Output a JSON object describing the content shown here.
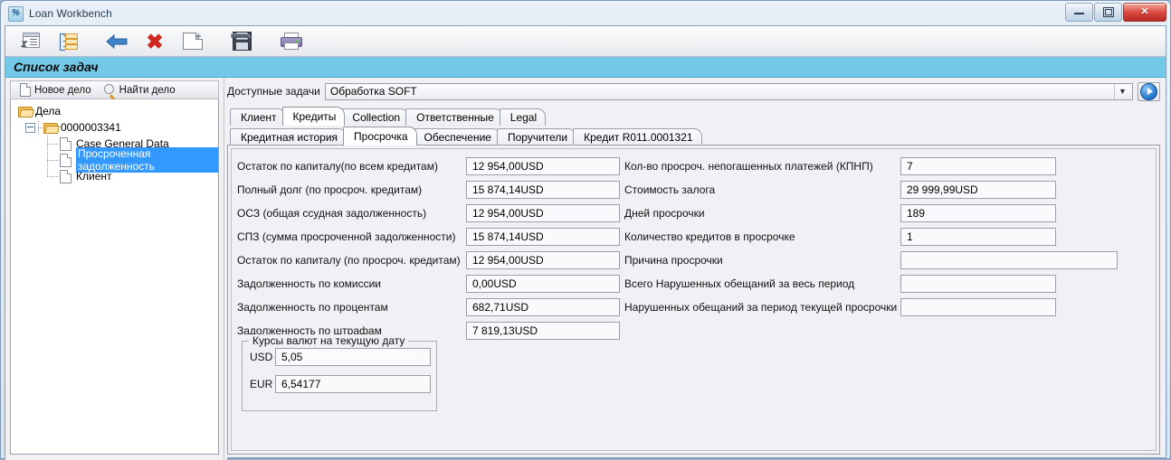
{
  "window": {
    "title": "Loan Workbench",
    "app_icon": "percent-icon",
    "controls": {
      "minimize": "minimize-icon",
      "maximize": "maximize-icon",
      "close": "✕"
    }
  },
  "toolbar": {
    "buttons": [
      {
        "name": "task-window-button",
        "icon": "task-window-icon"
      },
      {
        "name": "task-list-button",
        "icon": "list-tree-icon"
      },
      {
        "name": "back-button",
        "icon": "back-arrow-icon"
      },
      {
        "name": "delete-button",
        "icon": "red-cross-icon"
      },
      {
        "name": "new-document-button",
        "icon": "new-document-icon"
      },
      {
        "name": "save-button",
        "icon": "floppy-save-icon"
      },
      {
        "name": "print-button",
        "icon": "printer-icon"
      }
    ]
  },
  "band": {
    "title": "Список задач"
  },
  "left_panel": {
    "buttons": [
      {
        "label": "Новое дело",
        "icon": "document-icon"
      },
      {
        "label": "Найти дело",
        "icon": "magnifier-icon"
      }
    ],
    "tree": {
      "root": "Дела",
      "case_number": "0000003341",
      "children": [
        {
          "label": "Case General Data",
          "selected": false
        },
        {
          "label": "Просроченная задолженность",
          "selected": true
        },
        {
          "label": "Клиент",
          "selected": false
        }
      ]
    }
  },
  "main": {
    "task_selector": {
      "label": "Доступные задачи",
      "value": "Обработка SOFT",
      "caret": "▼",
      "go_button": "run-task-button"
    },
    "tabs_primary": [
      {
        "label": "Клиент",
        "active": false
      },
      {
        "label": "Кредиты",
        "active": true
      },
      {
        "label": "Collection",
        "active": false
      },
      {
        "label": "Ответственные",
        "active": false
      },
      {
        "label": "Legal",
        "active": false
      }
    ],
    "tabs_secondary": [
      {
        "label": "Кредитная история",
        "active": false
      },
      {
        "label": "Просрочка",
        "active": true
      },
      {
        "label": "Обеспечение",
        "active": false
      },
      {
        "label": "Поручители",
        "active": false
      },
      {
        "label": "Кредит R011.0001321",
        "active": false
      }
    ],
    "fields_left": [
      {
        "label": "Остаток по капиталу(по всем кредитам)",
        "value": "12 954,00USD"
      },
      {
        "label": "Полный долг (по просроч. кредитам)",
        "value": "15 874,14USD"
      },
      {
        "label": "ОСЗ (общая ссудная задолженность)",
        "value": "12 954,00USD"
      },
      {
        "label": "СПЗ (сумма просроченной задолженности)",
        "value": "15 874,14USD"
      },
      {
        "label": "Остаток по капиталу (по просроч. кредитам)",
        "value": "12 954,00USD"
      },
      {
        "label": "Задолженность по комиссии",
        "value": "0,00USD"
      },
      {
        "label": "Задолженность по процентам",
        "value": "682,71USD"
      },
      {
        "label": "Задолженность по штрафам",
        "value": "7 819,13USD"
      }
    ],
    "fields_right": [
      {
        "label": "Кол-во просроч. непогашенных платежей (КПНП)",
        "value": "7",
        "wide": false
      },
      {
        "label": "Стоимость залога",
        "value": "29 999,99USD",
        "wide": false
      },
      {
        "label": "Дней просрочки",
        "value": "189",
        "wide": false
      },
      {
        "label": "Количество кредитов в просрочке",
        "value": "1",
        "wide": false
      },
      {
        "label": "Причина просрочки",
        "value": "",
        "wide": true
      },
      {
        "label": "Всего Нарушенных обещаний за весь период",
        "value": "",
        "wide": false
      },
      {
        "label": "Нарушенных обещаний за период текущей просрочки",
        "value": "",
        "wide": false
      }
    ],
    "currency_group": {
      "title": "Курсы валют на текущую дату",
      "rows": [
        {
          "code": "USD",
          "rate": "5,05"
        },
        {
          "code": "EUR",
          "rate": "6,54177"
        }
      ]
    }
  },
  "colors": {
    "band": "#73c8e8",
    "selection": "#3399ff",
    "panel_bg": "#f0f0f5",
    "field_bg": "#fafafc",
    "close_button": "#d9453c"
  }
}
